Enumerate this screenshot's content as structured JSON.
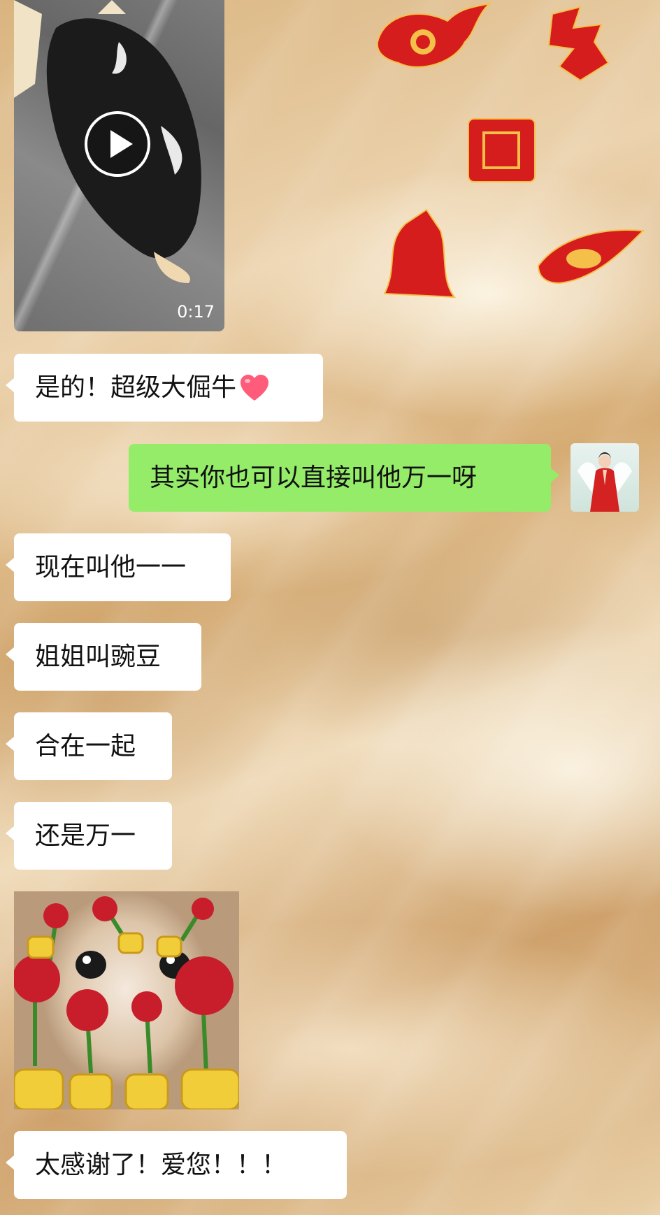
{
  "video": {
    "duration": "0:17"
  },
  "messages": [
    {
      "side": "left",
      "text": "是的！超级大倔牛"
    },
    {
      "side": "right",
      "text": "其实你也可以直接叫他万一呀"
    },
    {
      "side": "left",
      "text": "现在叫他一一"
    },
    {
      "side": "left",
      "text": "姐姐叫豌豆"
    },
    {
      "side": "left",
      "text": "合在一起"
    },
    {
      "side": "left",
      "text": "还是万一"
    },
    {
      "side": "left",
      "text": "太感谢了！爱您！！！"
    }
  ],
  "colors": {
    "incoming_bubble": "#ffffff",
    "outgoing_bubble": "#95ec69",
    "decor_red": "#d51d1d",
    "heart": "#ff5b7a"
  },
  "icons": [
    "play-icon",
    "heart-emoji",
    "avatar",
    "rose-sticker"
  ]
}
